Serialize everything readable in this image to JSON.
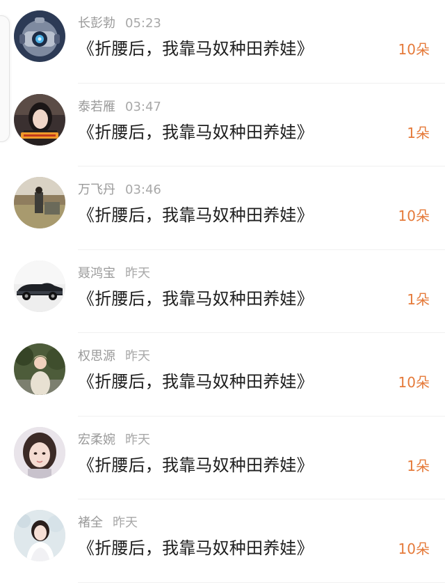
{
  "accent_color": "#e57a3a",
  "rows": [
    {
      "avatar": "robot-avatar-icon",
      "name": "长彭勃",
      "time": "05:23",
      "book": "《折腰后，我靠马奴种田养娃》",
      "gift": "10朵"
    },
    {
      "avatar": "girl-portrait-avatar-icon",
      "name": "泰若雁",
      "time": "03:47",
      "book": "《折腰后，我靠马奴种田养娃》",
      "gift": "1朵"
    },
    {
      "avatar": "field-scene-avatar-icon",
      "name": "万飞丹",
      "time": "03:46",
      "book": "《折腰后，我靠马奴种田养娃》",
      "gift": "10朵"
    },
    {
      "avatar": "vintage-car-avatar-icon",
      "name": "聂鸿宝",
      "time": "昨天",
      "book": "《折腰后，我靠马奴种田养娃》",
      "gift": "1朵"
    },
    {
      "avatar": "person-outdoors-avatar-icon",
      "name": "权思源",
      "time": "昨天",
      "book": "《折腰后，我靠马奴种田养娃》",
      "gift": "10朵"
    },
    {
      "avatar": "girl-face-avatar-icon",
      "name": "宏柔婉",
      "time": "昨天",
      "book": "《折腰后，我靠马奴种田养娃》",
      "gift": "1朵"
    },
    {
      "avatar": "bride-avatar-icon",
      "name": "褚全",
      "time": "昨天",
      "book": "《折腰后，我靠马奴种田养娃》",
      "gift": "10朵"
    }
  ]
}
